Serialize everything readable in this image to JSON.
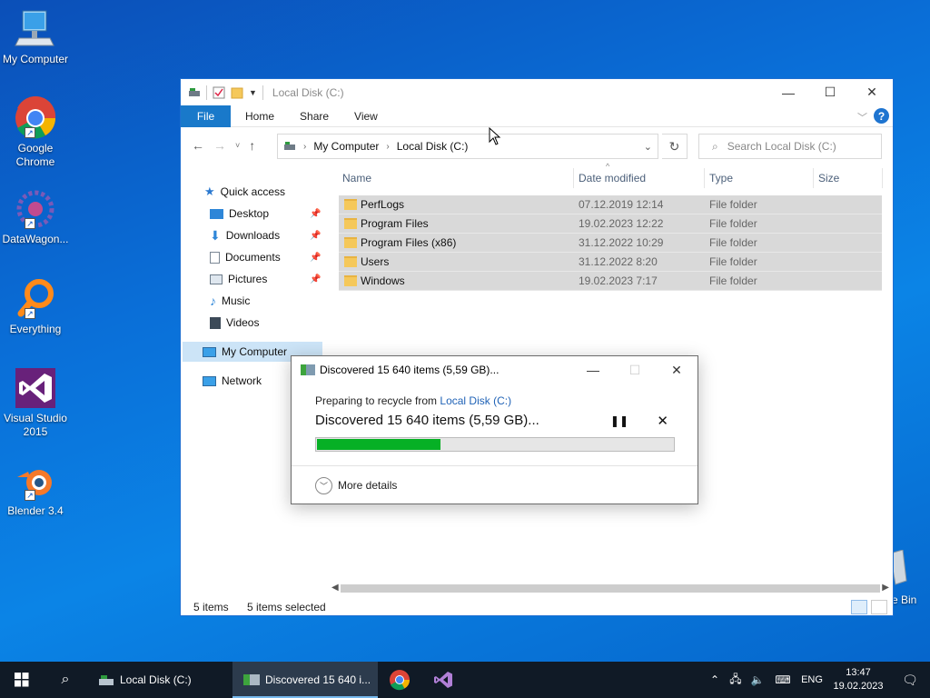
{
  "desktop": {
    "icons": [
      {
        "label": "My Computer"
      },
      {
        "label": "Google\nChrome"
      },
      {
        "label": "DataWagon..."
      },
      {
        "label": "Everything"
      },
      {
        "label": "Visual Studio\n2015"
      },
      {
        "label": "Blender 3.4"
      }
    ],
    "recycle_partial_label": "e Bin"
  },
  "explorer": {
    "title": "Local Disk (C:)",
    "ribbon": {
      "file": "File",
      "tabs": [
        "Home",
        "Share",
        "View"
      ],
      "help": "?"
    },
    "address": {
      "crumbs": [
        "My Computer",
        "Local Disk (C:)"
      ]
    },
    "search_placeholder": "Search Local Disk (C:)",
    "nav": {
      "quick_access": "Quick access",
      "items": [
        "Desktop",
        "Downloads",
        "Documents",
        "Pictures",
        "Music",
        "Videos"
      ],
      "my_computer": "My Computer",
      "network": "Network"
    },
    "columns": {
      "name": "Name",
      "date": "Date modified",
      "type": "Type",
      "size": "Size"
    },
    "rows": [
      {
        "name": "PerfLogs",
        "date": "07.12.2019 12:14",
        "type": "File folder"
      },
      {
        "name": "Program Files",
        "date": "19.02.2023 12:22",
        "type": "File folder"
      },
      {
        "name": "Program Files (x86)",
        "date": "31.12.2022 10:29",
        "type": "File folder"
      },
      {
        "name": "Users",
        "date": "31.12.2022 8:20",
        "type": "File folder"
      },
      {
        "name": "Windows",
        "date": "19.02.2023 7:17",
        "type": "File folder"
      }
    ],
    "status": {
      "count": "5 items",
      "selected": "5 items selected"
    }
  },
  "dialog": {
    "title": "Discovered 15 640 items (5,59 GB)...",
    "sub_prefix": "Preparing to recycle from ",
    "sub_link": "Local Disk (C:)",
    "main": "Discovered 15 640 items (5,59 GB)...",
    "progress_percent": 35,
    "more_details": "More details"
  },
  "taskbar": {
    "tasks": [
      "Local Disk (C:)",
      "Discovered 15 640 i..."
    ],
    "lang": "ENG",
    "time": "13:47",
    "date": "19.02.2023"
  },
  "colors": {
    "accent": "#1979ca",
    "progress": "#06b025",
    "selection": "#d9d9d9",
    "taskbar": "#101a26"
  }
}
